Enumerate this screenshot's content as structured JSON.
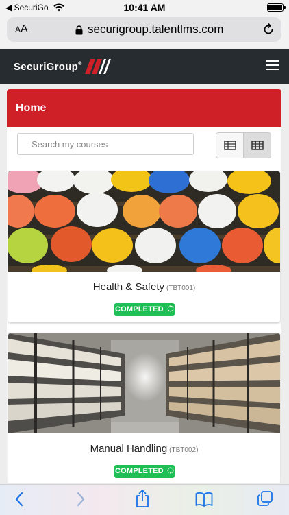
{
  "status_bar": {
    "carrier": "◀ SecuriGo",
    "time": "10:41 AM"
  },
  "address_bar": {
    "text_size_label": "AA",
    "url": "securigroup.talentlms.com"
  },
  "app_header": {
    "brand": "SecuriGroup",
    "brand_mark": "®"
  },
  "home": {
    "title": "Home",
    "search_placeholder": "Search my courses"
  },
  "courses": [
    {
      "name": "Health & Safety",
      "code": "(TBT001)",
      "status": "COMPLETED"
    },
    {
      "name": "Manual Handling",
      "code": "(TBT002)",
      "status": "COMPLETED"
    }
  ],
  "colors": {
    "header_dark": "#262c30",
    "brand_red": "#cf2027",
    "completed_green": "#20bf55",
    "ios_blue": "#1a73e8"
  },
  "icons": {
    "list_view": "list-view-icon",
    "grid_view": "grid-view-icon",
    "share": "share-icon",
    "bookmarks": "book-icon",
    "tabs": "tabs-icon"
  }
}
